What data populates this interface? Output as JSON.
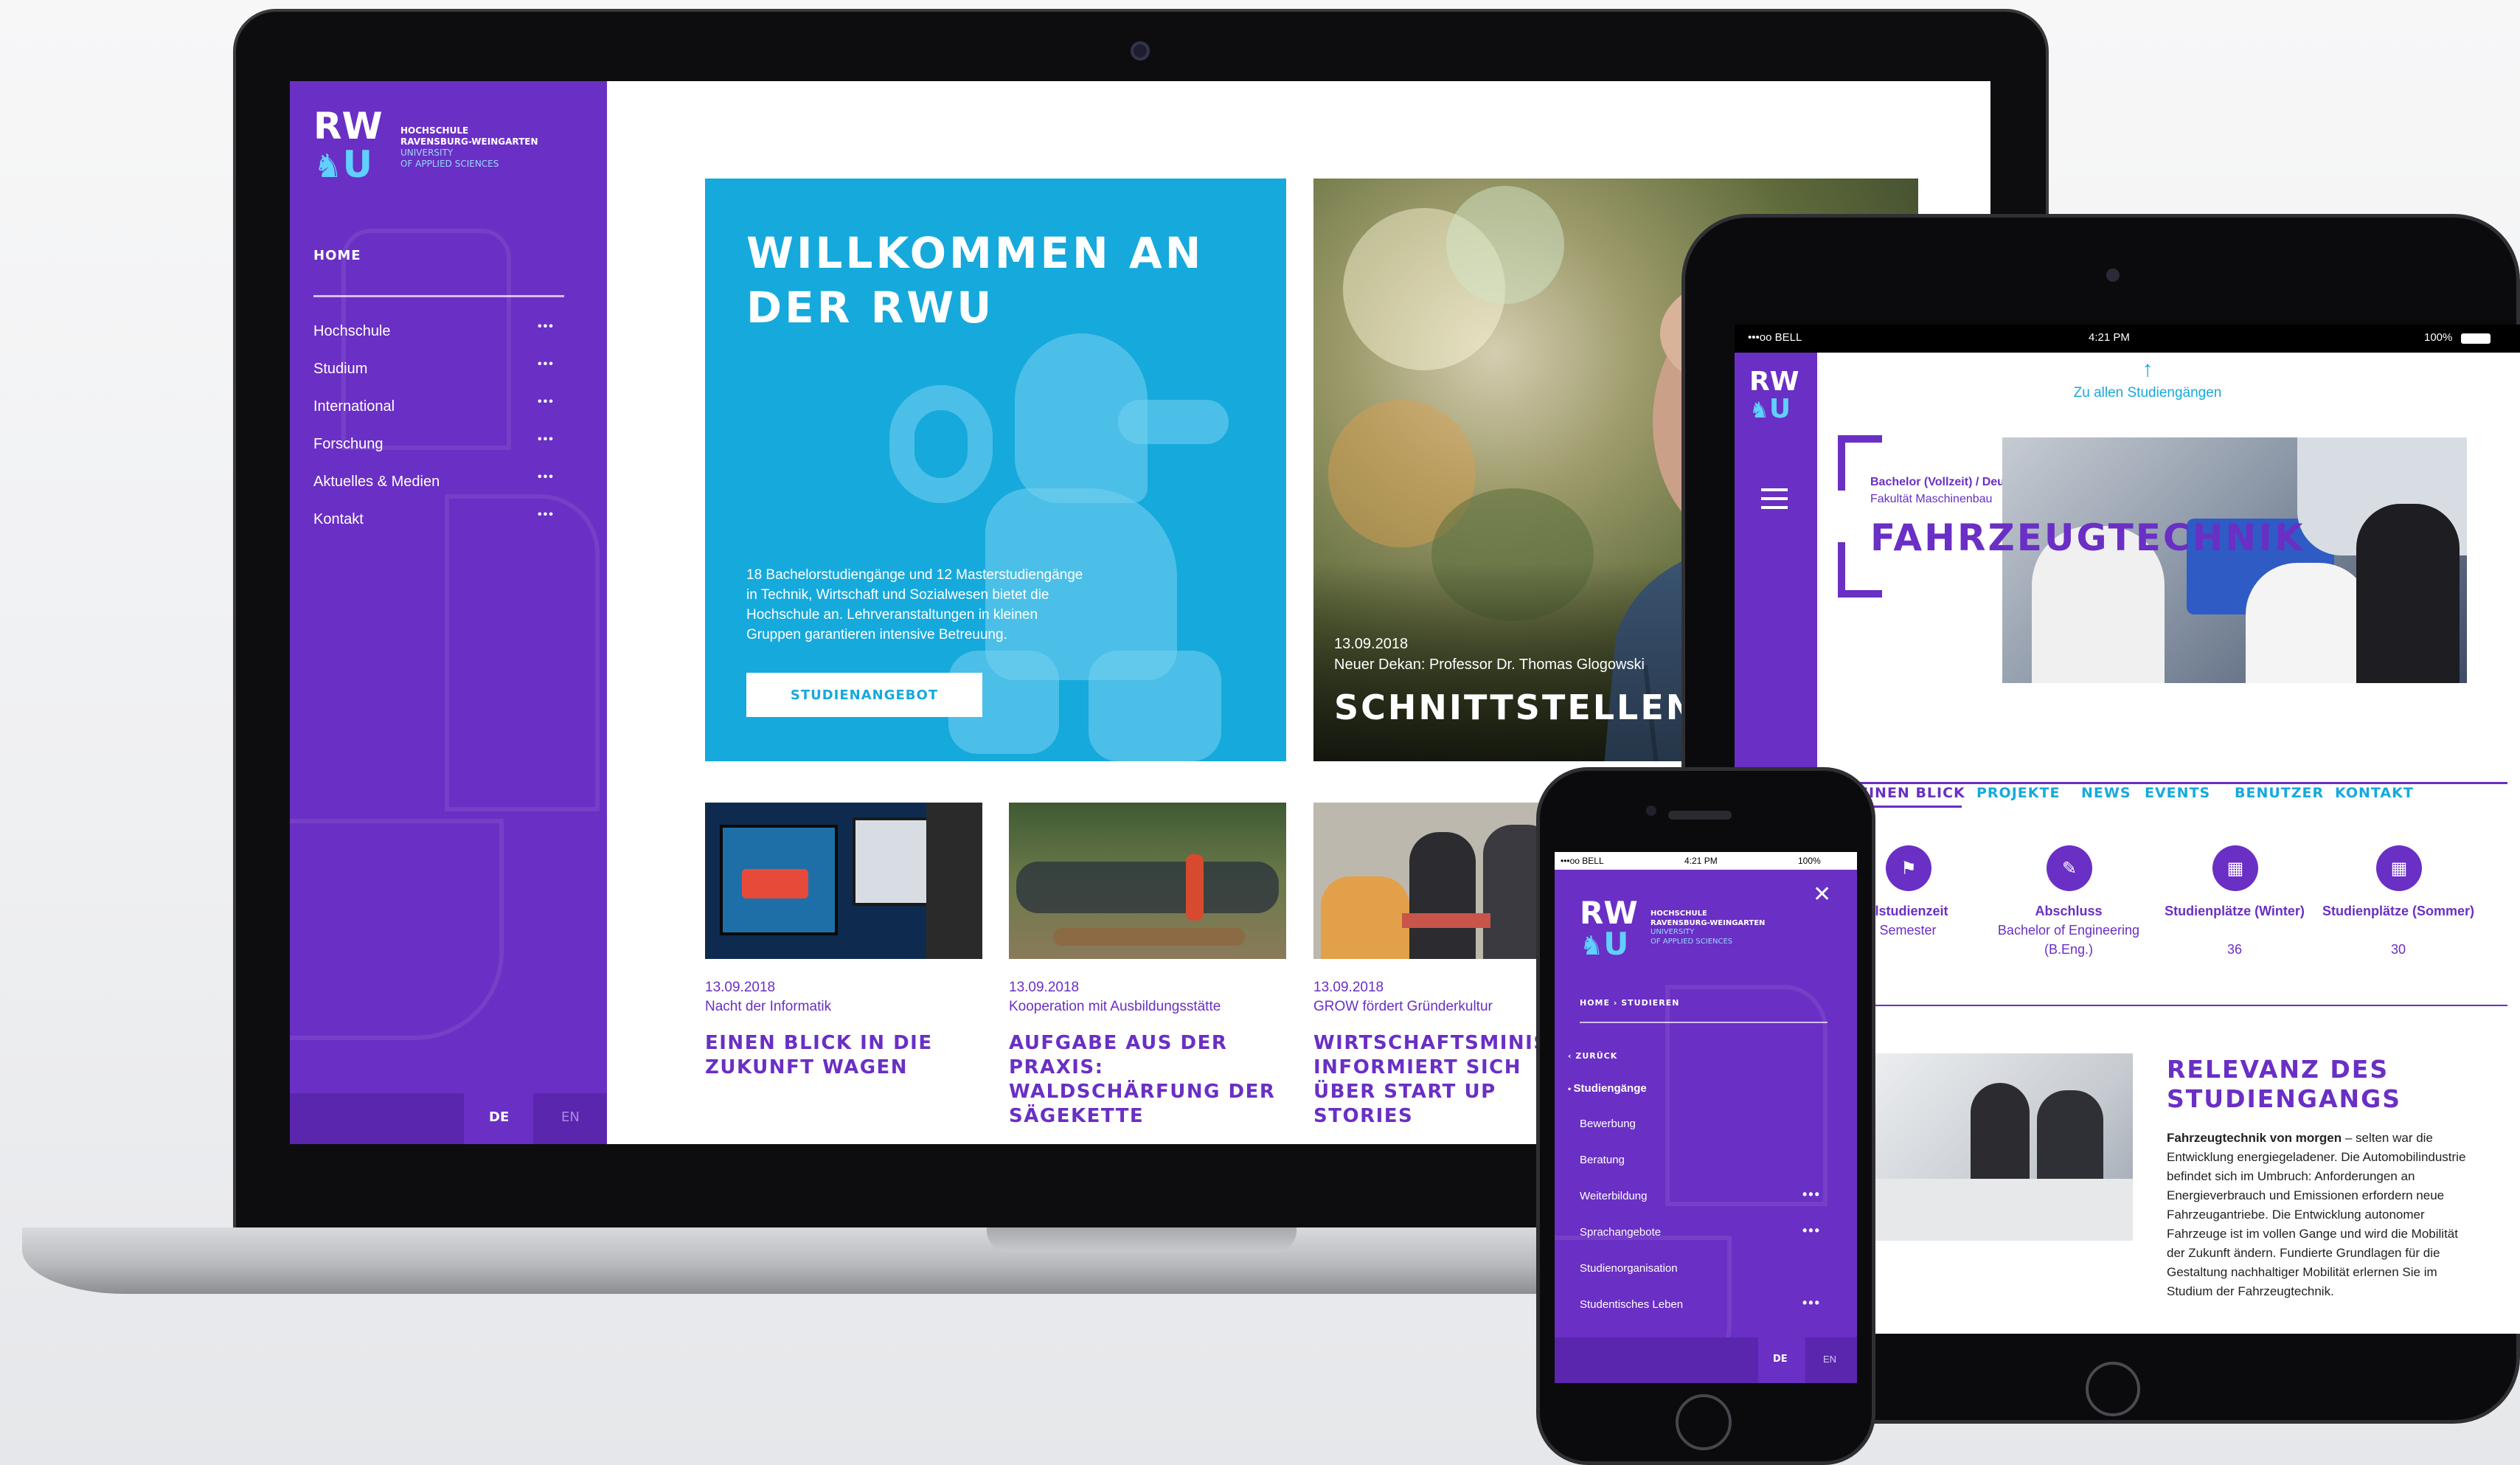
{
  "laptop": {
    "logo": {
      "rw": "RW",
      "u": "U",
      "line1": "HOCHSCHULE",
      "line2": "RAVENSBURG-WEINGARTEN",
      "line3": "UNIVERSITY",
      "line4": "OF APPLIED SCIENCES"
    },
    "nav": {
      "home": "HOME",
      "items": [
        {
          "label": "Hochschule",
          "dots": "•••"
        },
        {
          "label": "Studium",
          "dots": "•••"
        },
        {
          "label": "International",
          "dots": "•••"
        },
        {
          "label": "Forschung",
          "dots": "•••"
        },
        {
          "label": "Aktuelles & Medien",
          "dots": "•••"
        },
        {
          "label": "Kontakt",
          "dots": "•••"
        }
      ]
    },
    "lang": {
      "de": "DE",
      "en": "EN"
    },
    "hero": {
      "title_line1": "WILLKOMMEN AN",
      "title_line2": "DER RWU",
      "text": "18 Bachelorstudiengänge und 12 Masterstudiengänge in Technik, Wirtschaft und Sozialwesen bietet die Hochschule an. Lehrveranstaltungen in kleinen Gruppen garantieren intensive Betreuung.",
      "button": "STUDIENANGEBOT"
    },
    "feature": {
      "date": "13.09.2018",
      "subtitle": "Neuer Dekan: Professor Dr. Thomas Glogowski",
      "title": "SCHNITTSTELLEN INTE"
    },
    "news": [
      {
        "date": "13.09.2018",
        "subtitle": "Nacht der Informatik",
        "title": "EINEN BLICK IN DIE ZUKUNFT WAGEN"
      },
      {
        "date": "13.09.2018",
        "subtitle": "Kooperation mit Ausbildungsstätte",
        "title": "AUFGABE AUS DER PRAXIS: WALDSCHÄRFUNG DER SÄGEKETTE"
      },
      {
        "date": "13.09.2018",
        "subtitle": "GROW fördert Gründerkultur",
        "title": "WIRTSCHAFTSMINISTER INFORMIERT SICH ÜBER START UP STORIES"
      }
    ]
  },
  "tablet": {
    "status": {
      "carrier": "•••oo BELL",
      "time": "4:21 PM",
      "battery": "100%"
    },
    "logo": {
      "rw": "RW",
      "u": "U"
    },
    "back_link": "Zu allen Studiengängen",
    "program": {
      "meta_line1": "Bachelor (Vollzeit) / Deutsch",
      "meta_line2": "Fakultät Maschinenbau",
      "title": "FAHRZEUGTECHNIK"
    },
    "tabs": [
      "EINEN BLICK",
      "PROJEKTE",
      "NEWS",
      "EVENTS",
      "BENUTZER",
      "KONTAKT"
    ],
    "stats": [
      {
        "label": "elstudienzeit",
        "value": "Semester"
      },
      {
        "label": "Abschluss",
        "value": "Bachelor of Engineering (B.Eng.)"
      },
      {
        "label": "Studienplätze (Winter)",
        "value": "36"
      },
      {
        "label": "Studienplätze (Sommer)",
        "value": "30"
      }
    ],
    "relevance": {
      "title_line1": "RELEVANZ DES",
      "title_line2": "STUDIENGANGS",
      "lead": "Fahrzeugtechnik von morgen",
      "text": " – selten war die Entwicklung energiegeladener. Die Automobilindustrie befindet sich im Umbruch: Anforderungen an Energieverbrauch und Emissionen erfordern neue Fahrzeugantriebe. Die Entwicklung autonomer Fahrzeuge ist im vollen Gange und wird die Mobilität der Zukunft ändern. Fundierte Grundlagen für die Gestaltung nachhaltiger Mobilität erlernen Sie im Studium der Fahrzeugtechnik."
    }
  },
  "phone": {
    "status": {
      "carrier": "•••oo BELL",
      "time": "4:21 PM",
      "battery": "100%"
    },
    "logo": {
      "rw": "RW",
      "u": "U",
      "line1": "HOCHSCHULE",
      "line2": "RAVENSBURG-WEINGARTEN",
      "line3": "UNIVERSITY",
      "line4": "OF APPLIED SCIENCES"
    },
    "breadcrumb": "HOME  ›  STUDIEREN",
    "back": "‹  ZURÜCK",
    "active": "Studiengänge",
    "items": [
      {
        "label": "Bewerbung",
        "dots": ""
      },
      {
        "label": "Beratung",
        "dots": ""
      },
      {
        "label": "Weiterbildung",
        "dots": "•••"
      },
      {
        "label": "Sprachangebote",
        "dots": "•••"
      },
      {
        "label": "Studienorganisation",
        "dots": ""
      },
      {
        "label": "Studentisches Leben",
        "dots": "•••"
      }
    ],
    "lang": {
      "de": "DE",
      "en": "EN"
    }
  }
}
